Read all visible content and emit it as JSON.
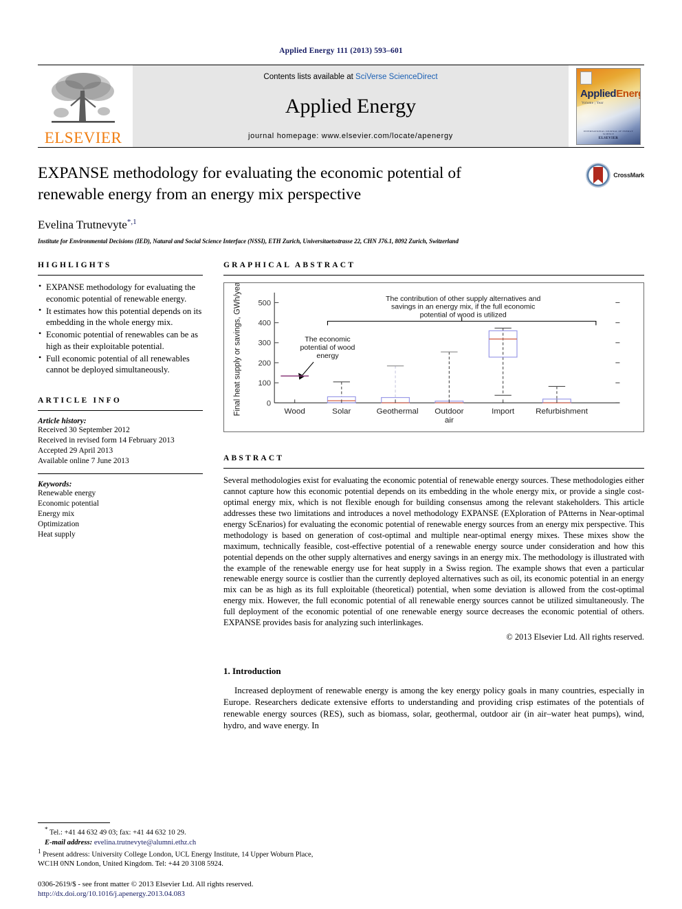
{
  "running_head": "Applied Energy 111 (2013) 593–601",
  "masthead": {
    "contents_prefix": "Contents lists available at ",
    "contents_link": "SciVerse ScienceDirect",
    "journal_title": "Applied Energy",
    "homepage": "journal homepage: www.elsevier.com/locate/apenergy",
    "publisher_logo_text": "ELSEVIER",
    "cover_title_a": "Applied",
    "cover_title_b": "Energy",
    "cover_subtitle": "Volume | Year",
    "cover_foot_small": "INTERNATIONAL JOURNAL OF ENERGY SCIENCE",
    "cover_foot_big": "ELSEVIER"
  },
  "article": {
    "title": "EXPANSE methodology for evaluating the economic potential of renewable energy from an energy mix perspective",
    "author": "Evelina Trutnevyte",
    "author_marks": "*,1",
    "affiliation": "Institute for Environmental Decisions (IED), Natural and Social Science Interface (NSSI), ETH Zurich, Universitaetsstrasse 22, CHN J76.1, 8092 Zurich, Switzerland",
    "crossmark_label": "CrossMark"
  },
  "highlights": {
    "heading": "Highlights",
    "items": [
      "EXPANSE methodology for evaluating the economic potential of renewable energy.",
      "It estimates how this potential depends on its embedding in the whole energy mix.",
      "Economic potential of renewables can be as high as their exploitable potential.",
      "Full economic potential of all renewables cannot be deployed simultaneously."
    ]
  },
  "graphical_abstract": {
    "heading": "Graphical abstract"
  },
  "chart_data": {
    "type": "box",
    "title": "",
    "xlabel": "",
    "ylabel": "Final heat supply or savings, GWh/year",
    "ylim": [
      0,
      550
    ],
    "yticks": [
      0,
      100,
      200,
      300,
      400,
      500
    ],
    "categories": [
      "Wood",
      "Solar",
      "Geothermal",
      "Outdoor air",
      "Import",
      "Refurbishment"
    ],
    "grid": false,
    "legend": "none",
    "annotations": [
      {
        "name": "wood-annotation",
        "text": "The economic potential of wood energy",
        "points_to": "Wood"
      },
      {
        "name": "bracket-annotation",
        "text": "The contribution of other supply alternatives and savings in an energy mix, if the full economic potential of wood is utilized",
        "spans": [
          "Solar",
          "Refurbishment"
        ]
      }
    ],
    "boxes": [
      {
        "category": "Wood",
        "whisker_low": 134,
        "q1": 134,
        "median": 134,
        "q3": 134,
        "whisker_high": 134,
        "style": "line-only"
      },
      {
        "category": "Solar",
        "whisker_low": 0,
        "q1": 0,
        "median": 11,
        "q3": 30,
        "whisker_high": 105
      },
      {
        "category": "Geothermal",
        "whisker_low": 0,
        "q1": 0,
        "median": 0,
        "q3": 27,
        "whisker_high": 184
      },
      {
        "category": "Outdoor air",
        "whisker_low": 0,
        "q1": 0,
        "median": 0,
        "q3": 9,
        "whisker_high": 254
      },
      {
        "category": "Import",
        "whisker_low": 38,
        "q1": 228,
        "median": 318,
        "q3": 359,
        "whisker_high": 371
      },
      {
        "category": "Refurbishment",
        "whisker_low": 0,
        "q1": 0,
        "median": 1,
        "q3": 19,
        "whisker_high": 82
      }
    ],
    "colors": {
      "box": "#9a9ae8",
      "median": "#d4644a",
      "whisker": "#4a4a4a",
      "axis": "#4a4a4a",
      "wood_line": "#8a3a7a"
    }
  },
  "article_info": {
    "heading": "Article info",
    "history_label": "Article history:",
    "history": [
      "Received 30 September 2012",
      "Received in revised form 14 February 2013",
      "Accepted 29 April 2013",
      "Available online 7 June 2013"
    ],
    "keywords_label": "Keywords:",
    "keywords": [
      "Renewable energy",
      "Economic potential",
      "Energy mix",
      "Optimization",
      "Heat supply"
    ]
  },
  "abstract": {
    "heading": "Abstract",
    "body": "Several methodologies exist for evaluating the economic potential of renewable energy sources. These methodologies either cannot capture how this economic potential depends on its embedding in the whole energy mix, or provide a single cost-optimal energy mix, which is not flexible enough for building consensus among the relevant stakeholders. This article addresses these two limitations and introduces a novel methodology EXPANSE (EXploration of PAtterns in Near-optimal energy ScEnarios) for evaluating the economic potential of renewable energy sources from an energy mix perspective. This methodology is based on generation of cost-optimal and multiple near-optimal energy mixes. These mixes show the maximum, technically feasible, cost-effective potential of a renewable energy source under consideration and how this potential depends on the other supply alternatives and energy savings in an energy mix. The methodology is illustrated with the example of the renewable energy use for heat supply in a Swiss region. The example shows that even a particular renewable energy source is costlier than the currently deployed alternatives such as oil, its economic potential in an energy mix can be as high as its full exploitable (theoretical) potential, when some deviation is allowed from the cost-optimal energy mix. However, the full economic potential of all renewable energy sources cannot be utilized simultaneously. The full deployment of the economic potential of one renewable energy source decreases the economic potential of others. EXPANSE provides basis for analyzing such interlinkages.",
    "copyright": "© 2013 Elsevier Ltd. All rights reserved."
  },
  "introduction": {
    "heading": "1. Introduction",
    "paragraph": "Increased deployment of renewable energy is among the key energy policy goals in many countries, especially in Europe. Researchers dedicate extensive efforts to understanding and providing crisp estimates of the potentials of renewable energy sources (RES), such as biomass, solar, geothermal, outdoor air (in air–water heat pumps), wind, hydro, and wave energy. In"
  },
  "footnotes": {
    "tel": "Tel.: +41 44 632 49 03; fax: +41 44 632 10 29.",
    "email_label": "E-mail address:",
    "email": "evelina.trutnevyte@alumni.ethz.ch",
    "present_address": "Present address: University College London, UCL Energy Institute, 14 Upper Woburn Place, WC1H 0NN London, United Kingdom. Tel: +44 20 3108 5924.",
    "issn_line": "0306-2619/$ - see front matter © 2013 Elsevier Ltd. All rights reserved.",
    "doi": "http://dx.doi.org/10.1016/j.apenergy.2013.04.083"
  }
}
